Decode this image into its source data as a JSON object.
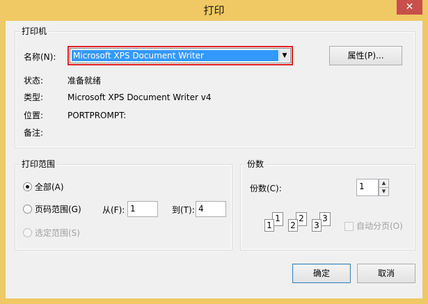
{
  "window": {
    "title": "打印",
    "close_glyph": "✕"
  },
  "printer_group": {
    "legend": "打印机",
    "name_label": "名称(N):",
    "name_value": "Microsoft XPS Document Writer",
    "properties_button": "属性(P)...",
    "status_label": "状态:",
    "status_value": "准备就绪",
    "type_label": "类型:",
    "type_value": "Microsoft XPS Document Writer v4",
    "where_label": "位置:",
    "where_value": "PORTPROMPT:",
    "comment_label": "备注:"
  },
  "range_group": {
    "legend": "打印范围",
    "all_label": "全部(A)",
    "pages_label": "页码范围(G)",
    "from_label": "从(F):",
    "from_value": "1",
    "to_label": "到(T):",
    "to_value": "4",
    "selection_label": "选定范围(S)",
    "selected_option": "all"
  },
  "copies_group": {
    "legend": "份数",
    "copies_label": "份数(C):",
    "copies_value": "1",
    "collate_label": "自动分页(O)",
    "collate_checked": false,
    "page_numbers": [
      "1",
      "1",
      "2",
      "2",
      "3",
      "3"
    ]
  },
  "footer": {
    "ok_button": "确定",
    "cancel_button": "取消"
  }
}
